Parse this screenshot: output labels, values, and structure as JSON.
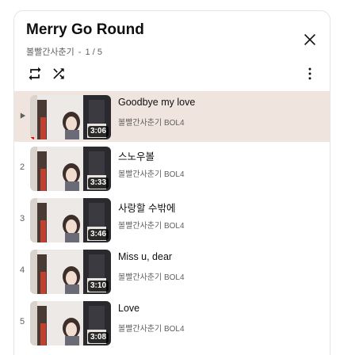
{
  "playlist": {
    "title": "Merry Go Round",
    "channel": "볼빨간사춘기",
    "separator": "-",
    "position": "1 / 5"
  },
  "icons": {
    "loop": "loop-icon",
    "shuffle": "shuffle-icon",
    "close": "close-icon",
    "more": "more-vert-icon",
    "now_playing": "play-arrow-icon"
  },
  "colors": {
    "active_row": "#f0e4de",
    "progress": "#ff0000"
  },
  "items": [
    {
      "index": "▶",
      "title": "Goodbye my love",
      "channel": "볼빨간사춘기 BOL4",
      "duration": "3:06",
      "active": true,
      "progress": 0.05
    },
    {
      "index": "2",
      "title": "스노우볼",
      "channel": "볼빨간사춘기 BOL4",
      "duration": "3:33",
      "active": false
    },
    {
      "index": "3",
      "title": "사랑할 수밖에",
      "channel": "볼빨간사춘기 BOL4",
      "duration": "3:46",
      "active": false
    },
    {
      "index": "4",
      "title": "Miss u, dear",
      "channel": "볼빨간사춘기 BOL4",
      "duration": "3:10",
      "active": false
    },
    {
      "index": "5",
      "title": "Love",
      "channel": "볼빨간사춘기 BOL4",
      "duration": "3:08",
      "active": false
    }
  ]
}
